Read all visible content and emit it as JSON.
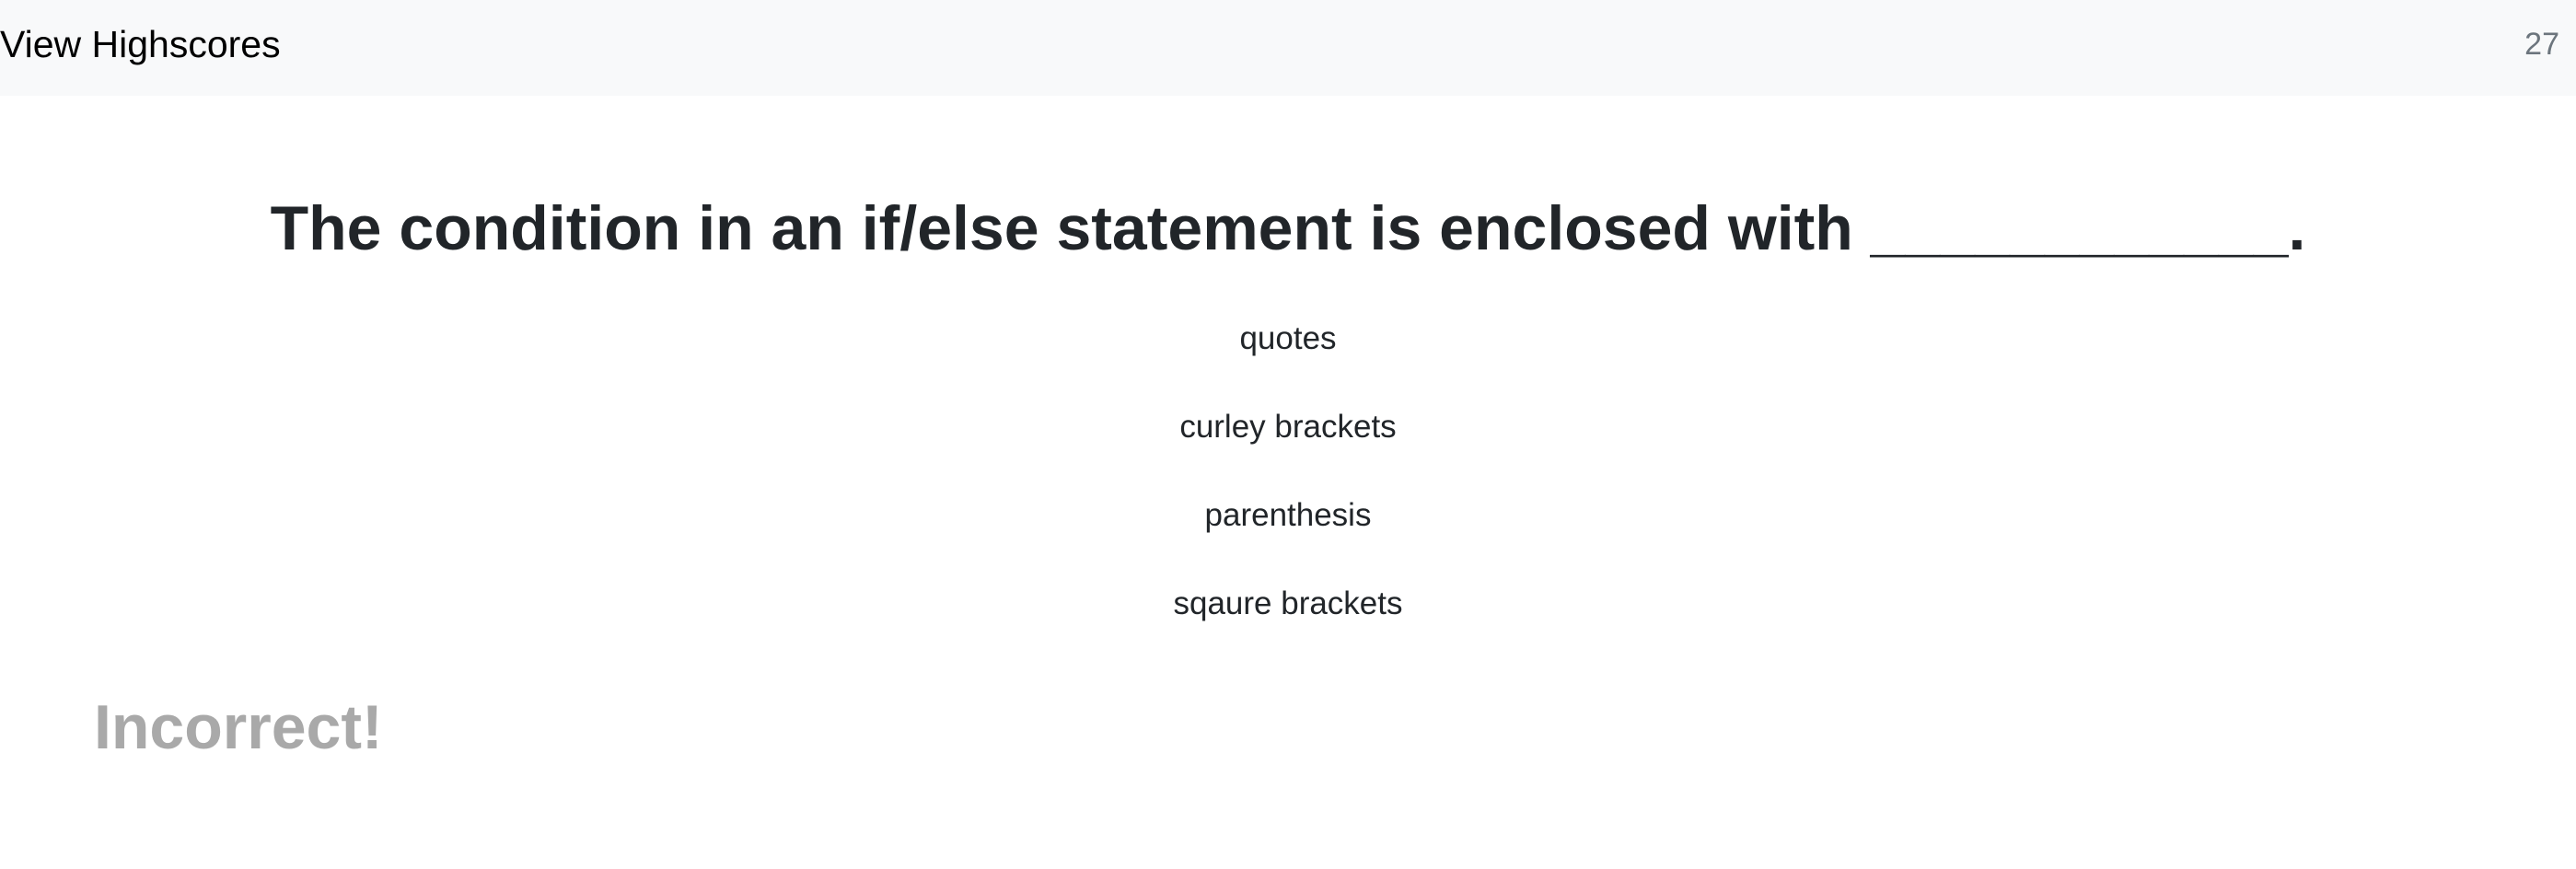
{
  "navbar": {
    "highscores_link": "View Highscores",
    "timer": "27"
  },
  "quiz": {
    "question": "The condition in an if/else statement is enclosed with ____________.",
    "choices": [
      {
        "label": "quotes"
      },
      {
        "label": "curley brackets"
      },
      {
        "label": "parenthesis"
      },
      {
        "label": "sqaure brackets"
      }
    ],
    "feedback": "Incorrect!"
  }
}
